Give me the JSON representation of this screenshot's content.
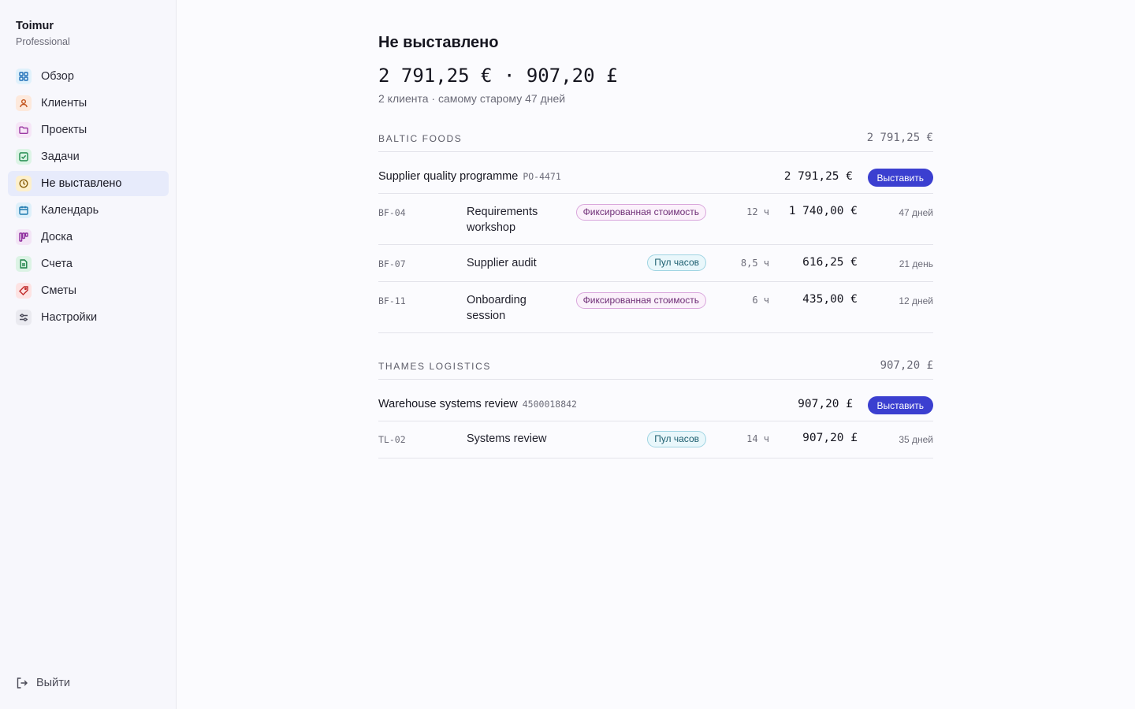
{
  "brand": {
    "name": "Toimur",
    "plan": "Professional"
  },
  "sidebar": {
    "items": [
      {
        "label": "Обзор"
      },
      {
        "label": "Клиенты"
      },
      {
        "label": "Проекты"
      },
      {
        "label": "Задачи"
      },
      {
        "label": "Не выставлено"
      },
      {
        "label": "Календарь"
      },
      {
        "label": "Доска"
      },
      {
        "label": "Счета"
      },
      {
        "label": "Сметы"
      },
      {
        "label": "Настройки"
      }
    ],
    "logout": "Выйти"
  },
  "page": {
    "title": "Не выставлено",
    "totals": "2 791,25 € · 907,20 £",
    "subtitle": "2 клиента · самому старому 47 дней"
  },
  "colors": {
    "accent": "#3b3fd0",
    "active_nav": "#e7ebfb",
    "tag_fixed": "#d9a7dc",
    "tag_pool": "#9fd4e2"
  },
  "groups": [
    {
      "name": "BALTIC FOODS",
      "total": "2 791,25 €",
      "project": {
        "name": "Supplier quality programme",
        "ref": "PO-4471",
        "amount": "2 791,25 €",
        "button": "Выставить"
      },
      "items": [
        {
          "code": "BF-04",
          "desc": "Requirements workshop",
          "tag": "Фиксированная стоимость",
          "hours": "12 ч",
          "amount": "1 740,00 €",
          "age": "47 дней"
        },
        {
          "code": "BF-07",
          "desc": "Supplier audit",
          "tag": "Пул часов",
          "hours": "8,5 ч",
          "amount": "616,25 €",
          "age": "21 день"
        },
        {
          "code": "BF-11",
          "desc": "Onboarding session",
          "tag": "Фиксированная стоимость",
          "hours": "6 ч",
          "amount": "435,00 €",
          "age": "12 дней"
        }
      ]
    },
    {
      "name": "THAMES LOGISTICS",
      "total": "907,20 £",
      "project": {
        "name": "Warehouse systems review",
        "ref": "4500018842",
        "amount": "907,20 £",
        "button": "Выставить"
      },
      "items": [
        {
          "code": "TL-02",
          "desc": "Systems review",
          "tag": "Пул часов",
          "hours": "14 ч",
          "amount": "907,20 £",
          "age": "35 дней"
        }
      ]
    }
  ]
}
